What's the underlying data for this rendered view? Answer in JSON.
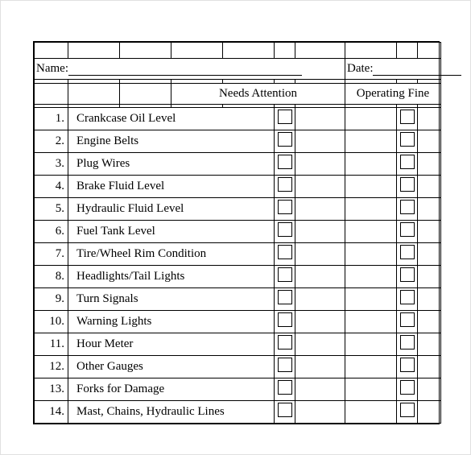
{
  "header": {
    "name_label": "Name:",
    "date_label": "Date:"
  },
  "columns": {
    "needs_attention": "Needs Attention",
    "operating_fine": "Operating Fine"
  },
  "items": [
    {
      "num": "1.",
      "label": "Crankcase Oil Level"
    },
    {
      "num": "2.",
      "label": "Engine Belts"
    },
    {
      "num": "3.",
      "label": "Plug Wires"
    },
    {
      "num": "4.",
      "label": "Brake Fluid Level"
    },
    {
      "num": "5.",
      "label": "Hydraulic Fluid Level"
    },
    {
      "num": "6.",
      "label": "Fuel Tank Level"
    },
    {
      "num": "7.",
      "label": "Tire/Wheel Rim Condition"
    },
    {
      "num": "8.",
      "label": "Headlights/Tail Lights"
    },
    {
      "num": "9.",
      "label": "Turn Signals"
    },
    {
      "num": "10.",
      "label": "Warning Lights"
    },
    {
      "num": "11.",
      "label": "Hour Meter"
    },
    {
      "num": "12.",
      "label": "Other Gauges"
    },
    {
      "num": "13.",
      "label": "Forks for Damage"
    },
    {
      "num": "14.",
      "label": "Mast, Chains, Hydraulic Lines"
    }
  ]
}
